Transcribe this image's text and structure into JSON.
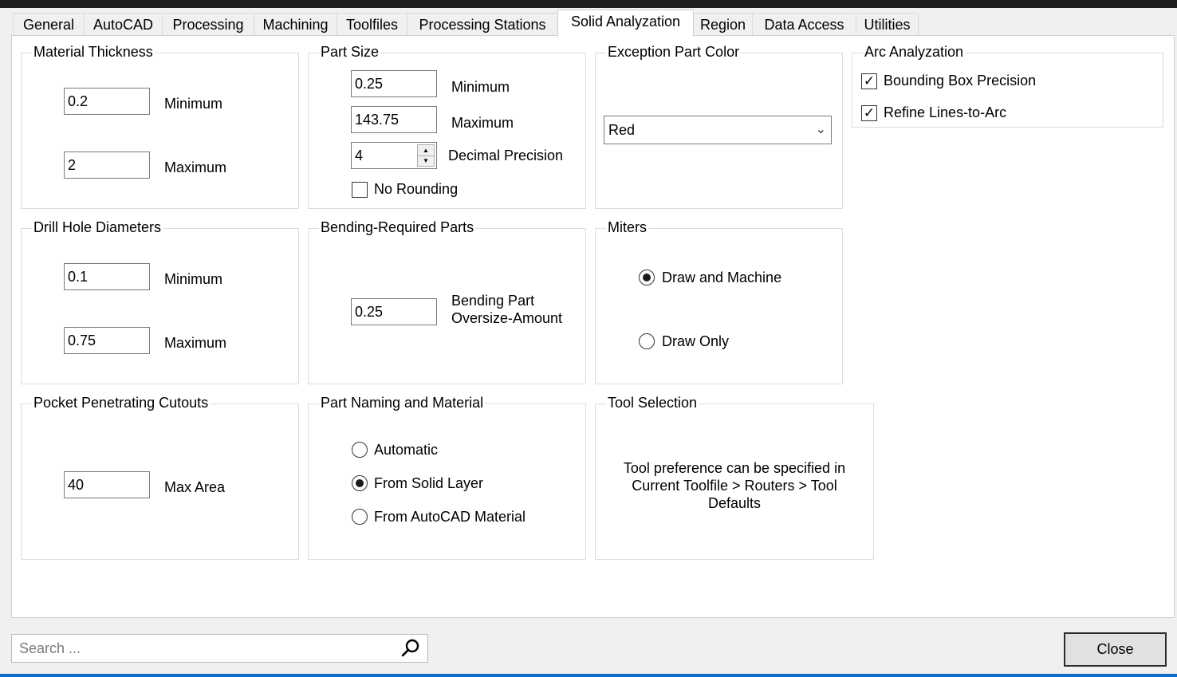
{
  "tabs": [
    {
      "label": "General",
      "active": false
    },
    {
      "label": "AutoCAD",
      "active": false
    },
    {
      "label": "Processing",
      "active": false
    },
    {
      "label": "Machining",
      "active": false
    },
    {
      "label": "Toolfiles",
      "active": false
    },
    {
      "label": "Processing Stations",
      "active": false
    },
    {
      "label": "Solid Analyzation",
      "active": true
    },
    {
      "label": "Region",
      "active": false
    },
    {
      "label": "Data Access",
      "active": false
    },
    {
      "label": "Utilities",
      "active": false
    }
  ],
  "material_thickness": {
    "title": "Material Thickness",
    "minimum_value": "0.2",
    "minimum_label": "Minimum",
    "maximum_value": "2",
    "maximum_label": "Maximum"
  },
  "part_size": {
    "title": "Part Size",
    "minimum_value": "0.25",
    "minimum_label": "Minimum",
    "maximum_value": "143.75",
    "maximum_label": "Maximum",
    "decimal_value": "4",
    "decimal_label": "Decimal Precision",
    "no_rounding_label": "No Rounding",
    "no_rounding_checked": false
  },
  "exception_part_color": {
    "title": "Exception Part Color",
    "selected": "Red",
    "chevron_icon": "chevron-down-icon"
  },
  "arc_analyzation": {
    "title": "Arc Analyzation",
    "bounding_box_label": "Bounding Box Precision",
    "bounding_box_checked": true,
    "refine_label": "Refine Lines-to-Arc",
    "refine_checked": true
  },
  "drill_hole": {
    "title": "Drill Hole Diameters",
    "minimum_value": "0.1",
    "minimum_label": "Minimum",
    "maximum_value": "0.75",
    "maximum_label": "Maximum"
  },
  "bending": {
    "title": "Bending-Required Parts",
    "value": "0.25",
    "label_line1": "Bending Part",
    "label_line2": "Oversize-Amount"
  },
  "miters": {
    "title": "Miters",
    "options": [
      {
        "label": "Draw and Machine",
        "selected": true
      },
      {
        "label": "Draw Only",
        "selected": false
      }
    ]
  },
  "pocket": {
    "title": "Pocket Penetrating Cutouts",
    "value": "40",
    "label": "Max Area"
  },
  "part_naming": {
    "title": "Part Naming and Material",
    "options": [
      {
        "label": "Automatic",
        "selected": false
      },
      {
        "label": "From Solid Layer",
        "selected": true
      },
      {
        "label": "From AutoCAD Material",
        "selected": false
      }
    ]
  },
  "tool_selection": {
    "title": "Tool Selection",
    "line1": "Tool preference can be specified in",
    "line2": "Current Toolfile > Routers > Tool",
    "line3": "Defaults"
  },
  "search": {
    "placeholder": "Search ...",
    "icon": "search-icon"
  },
  "close_button": {
    "label": "Close"
  }
}
